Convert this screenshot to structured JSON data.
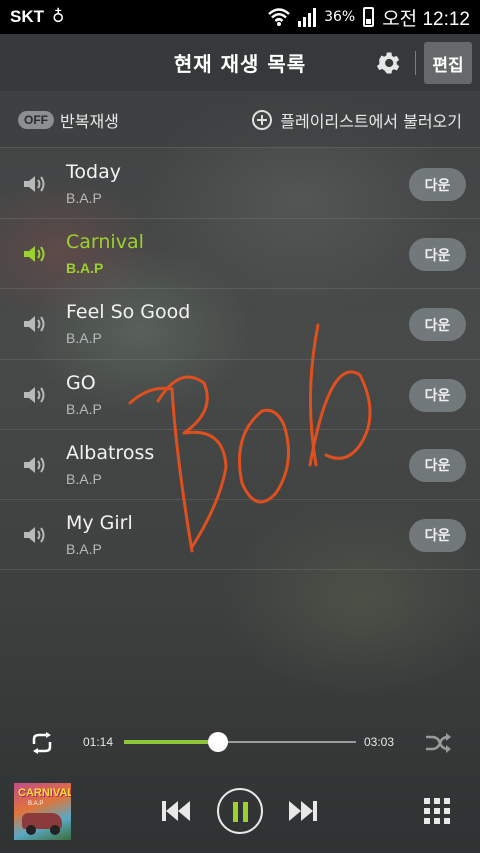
{
  "status_bar": {
    "carrier": "SKT",
    "battery": "36%",
    "time": "오전 12:12"
  },
  "header": {
    "title": "현재 재생 목록",
    "edit_label": "편집"
  },
  "controls": {
    "repeat_toggle": "OFF",
    "repeat_label": "반복재생",
    "load_playlist_label": "플레이리스트에서 불러오기"
  },
  "tracks": [
    {
      "title": "Today",
      "artist": "B.A.P",
      "down_label": "다운",
      "playing": false
    },
    {
      "title": "Carnival",
      "artist": "B.A.P",
      "down_label": "다운",
      "playing": true
    },
    {
      "title": "Feel So Good",
      "artist": "B.A.P",
      "down_label": "다운",
      "playing": false
    },
    {
      "title": "GO",
      "artist": "B.A.P",
      "down_label": "다운",
      "playing": false
    },
    {
      "title": "Albatross",
      "artist": "B.A.P",
      "down_label": "다운",
      "playing": false
    },
    {
      "title": "My Girl",
      "artist": "B.A.P",
      "down_label": "다운",
      "playing": false
    }
  ],
  "player": {
    "current_time": "01:14",
    "total_time": "03:03",
    "progress_fraction": 0.404,
    "album_art_title": "CARNIVAL",
    "album_art_subtitle": "B.A.P"
  },
  "colors": {
    "accent": "#9bd22f",
    "scribble": "#e0501e"
  },
  "icons": [
    "speaker-icon",
    "gear-icon",
    "plus-circle-icon",
    "repeat-icon",
    "shuffle-icon",
    "previous-icon",
    "pause-icon",
    "next-icon",
    "grid-icon"
  ]
}
